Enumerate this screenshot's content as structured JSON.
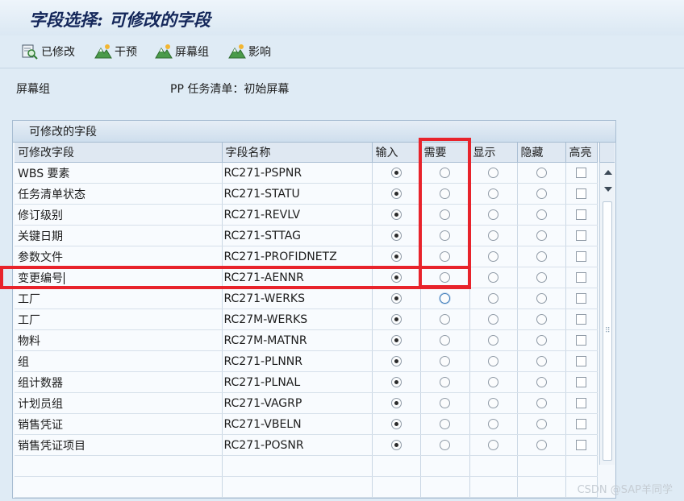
{
  "window": {
    "title": "字段选择: 可修改的字段"
  },
  "toolbar": {
    "modified": "已修改",
    "intervene": "干预",
    "screen_group": "屏幕组",
    "influence": "影响"
  },
  "info": {
    "label": "屏幕组",
    "value": "PP 任务清单：初始屏幕"
  },
  "panel": {
    "title": "可修改的字段"
  },
  "columns": {
    "field": "可修改字段",
    "name": "字段名称",
    "input": "输入",
    "required": "需要",
    "display": "显示",
    "hidden": "隐藏",
    "highlight": "高亮"
  },
  "rows": [
    {
      "field": "WBS 要素",
      "name": "RC271-PSPNR",
      "selected": "input",
      "highlight": false
    },
    {
      "field": "任务清单状态",
      "name": "RC271-STATU",
      "selected": "input",
      "highlight": false
    },
    {
      "field": "修订级别",
      "name": "RC271-REVLV",
      "selected": "input",
      "highlight": false
    },
    {
      "field": "关键日期",
      "name": "RC271-STTAG",
      "selected": "input",
      "highlight": false
    },
    {
      "field": "参数文件",
      "name": "RC271-PROFIDNETZ",
      "selected": "input",
      "highlight": false
    },
    {
      "field": "变更编号",
      "name": "RC271-AENNR",
      "selected": "input",
      "highlight": false
    },
    {
      "field": "工厂",
      "name": "RC271-WERKS",
      "selected": "input",
      "highlight": false
    },
    {
      "field": "工厂",
      "name": "RC27M-WERKS",
      "selected": "input",
      "highlight": false
    },
    {
      "field": "物料",
      "name": "RC27M-MATNR",
      "selected": "input",
      "highlight": false
    },
    {
      "field": "组",
      "name": "RC271-PLNNR",
      "selected": "input",
      "highlight": false
    },
    {
      "field": "组计数器",
      "name": "RC271-PLNAL",
      "selected": "input",
      "highlight": false
    },
    {
      "field": "计划员组",
      "name": "RC271-VAGRP",
      "selected": "input",
      "highlight": false
    },
    {
      "field": "销售凭证",
      "name": "RC271-VBELN",
      "selected": "input",
      "highlight": false
    },
    {
      "field": "销售凭证项目",
      "name": "RC271-POSNR",
      "selected": "input",
      "highlight": false
    }
  ],
  "watermark": "CSDN @SAP羊同学",
  "colors": {
    "highlight_box": "#e8232b",
    "title_text": "#14275a"
  }
}
